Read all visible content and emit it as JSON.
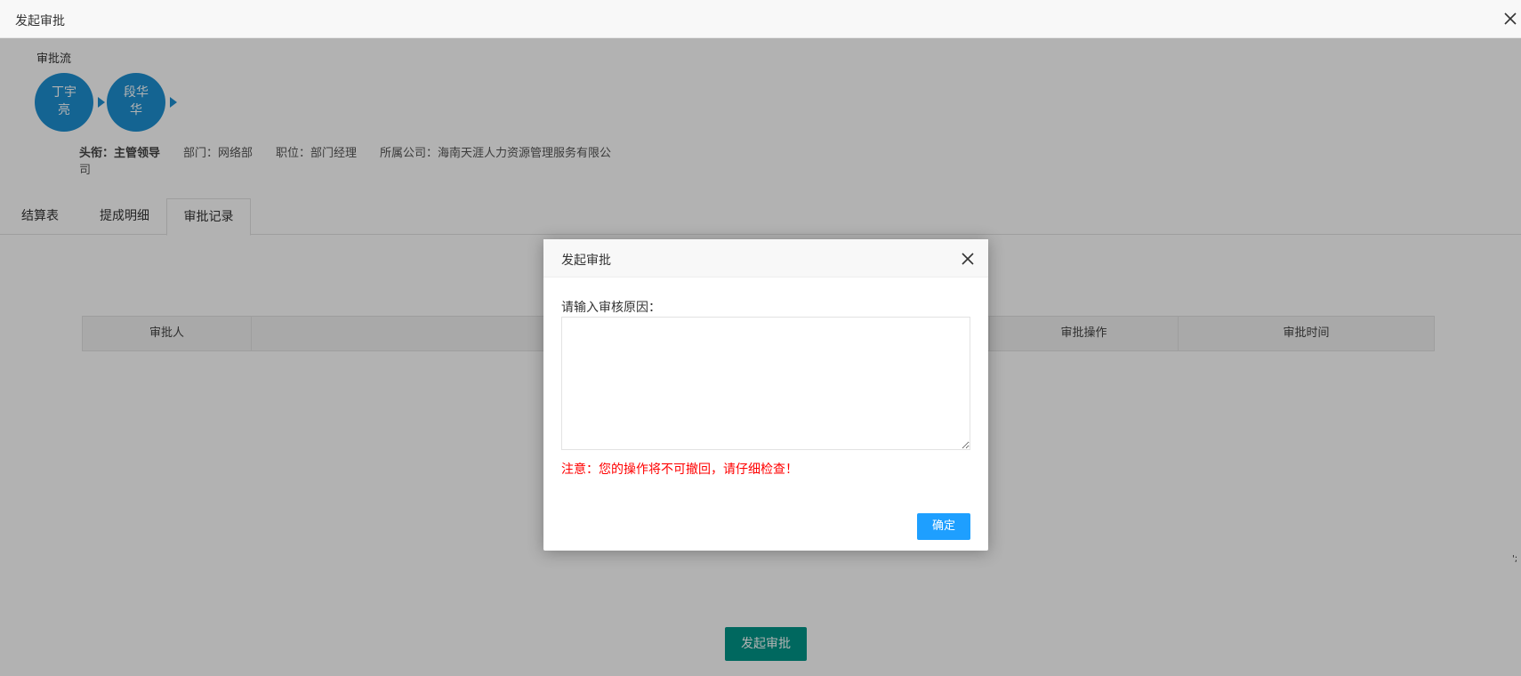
{
  "window": {
    "title": "发起审批"
  },
  "flow": {
    "label": "审批流",
    "nodes": [
      {
        "line1": "丁宇",
        "line2": "亮"
      },
      {
        "line1": "段华",
        "line2": "华"
      }
    ]
  },
  "info": {
    "title": "头衔：主管领导",
    "department": "部门：网络部",
    "position": "职位：部门经理",
    "company": "所属公司：海南天涯人力资源管理服务有限公司"
  },
  "tabs": [
    {
      "label": "结算表"
    },
    {
      "label": "提成明细"
    },
    {
      "label": "审批记录",
      "active": true
    }
  ],
  "table": {
    "headers": [
      "审批人",
      "",
      "审批操作",
      "审批时间"
    ]
  },
  "side_mark": "';",
  "submit_label": "发起审批",
  "modal": {
    "title": "发起审批",
    "field_label": "请输入审核原因：",
    "reason_value": "",
    "warning": "注意：您的操作将不可撤回，请仔细检查！",
    "confirm_label": "确定"
  },
  "colors": {
    "node": "#1e90d2",
    "submit": "#009688",
    "confirm": "#1e9fff",
    "warning": "#ff0000"
  }
}
